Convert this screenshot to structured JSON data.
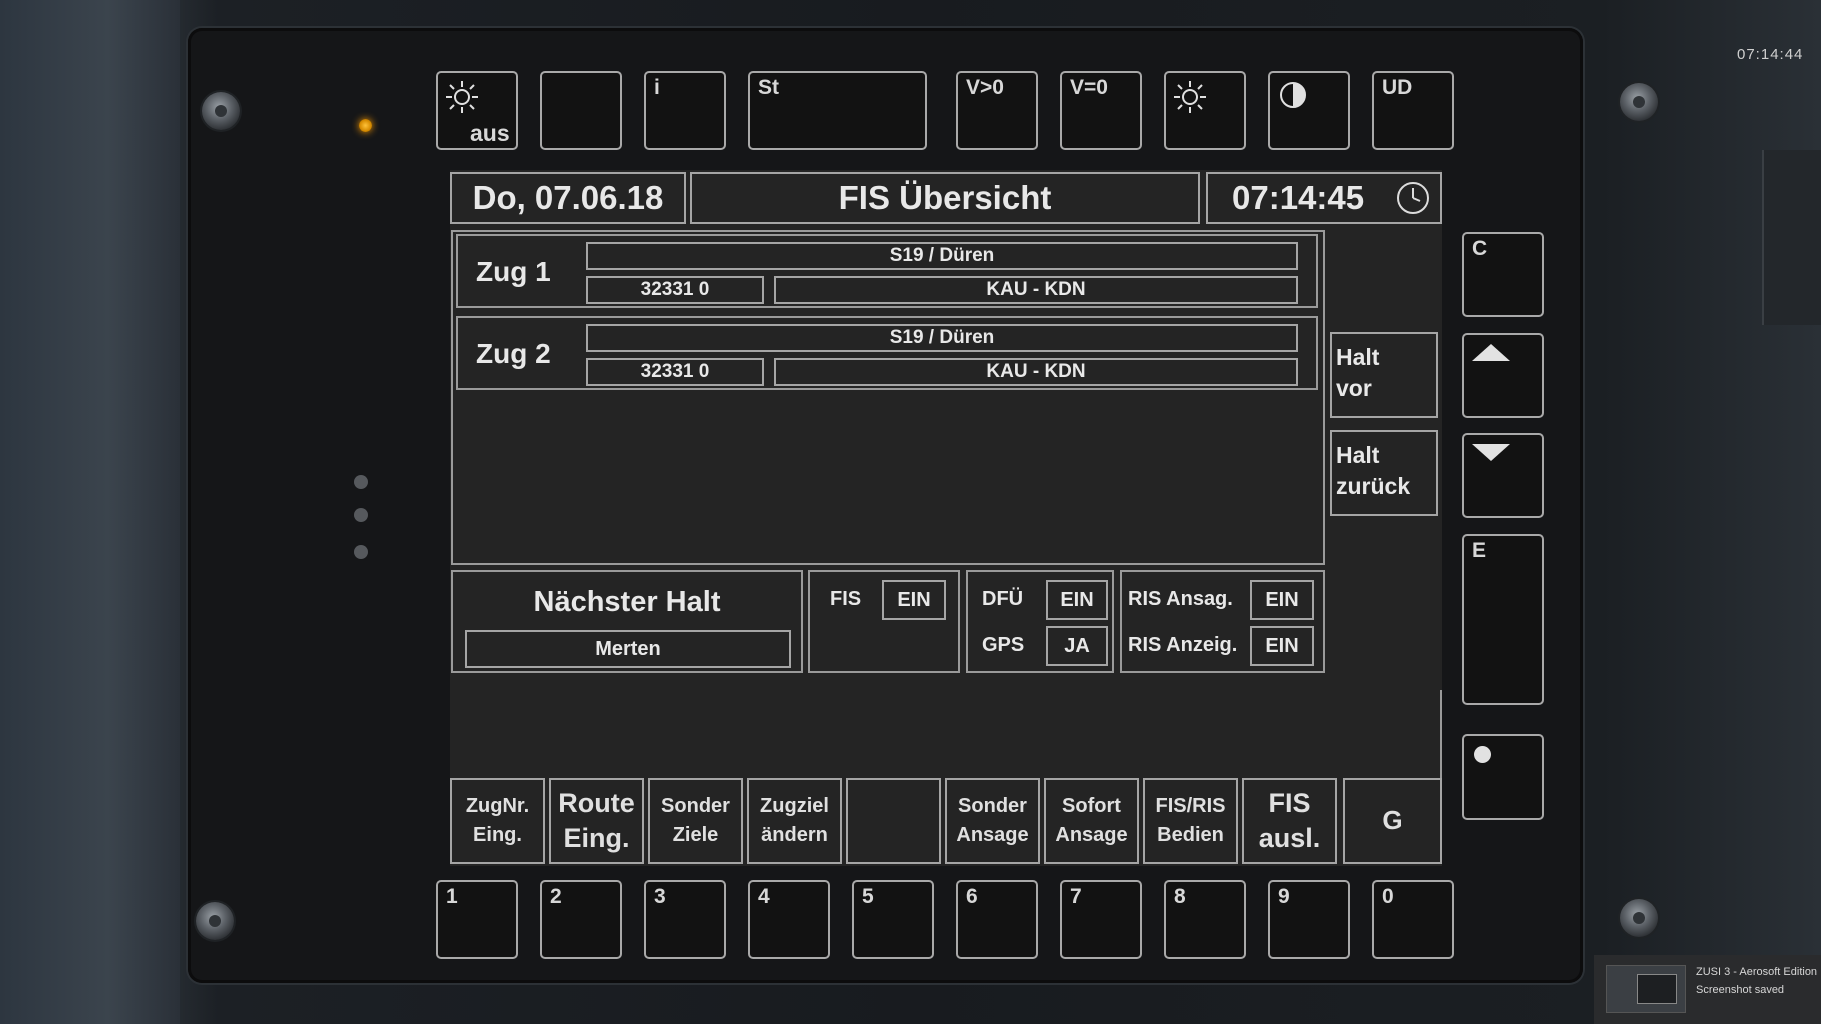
{
  "corner_clock": "07:14:44",
  "top_keys": [
    {
      "id": "brightness-off",
      "label": "aus",
      "icon": "sun-icon"
    },
    {
      "id": "blank",
      "label": ""
    },
    {
      "id": "info",
      "label": "i"
    },
    {
      "id": "st",
      "label": "St"
    },
    {
      "id": "v-gt-0",
      "label": "V>0"
    },
    {
      "id": "v-eq-0",
      "label": "V=0"
    },
    {
      "id": "brightness",
      "label": "",
      "icon": "sun-icon"
    },
    {
      "id": "contrast",
      "label": "",
      "icon": "contrast-icon"
    },
    {
      "id": "ud",
      "label": "UD"
    }
  ],
  "header": {
    "date": "Do, 07.06.18",
    "title": "FIS Übersicht",
    "time": "07:14:45",
    "clock_icon": "clock-icon"
  },
  "trains": [
    {
      "label": "Zug 1",
      "line": "S19 / Düren",
      "number": "32331 0",
      "route": "KAU - KDN"
    },
    {
      "label": "Zug 2",
      "line": "S19 / Düren",
      "number": "32331 0",
      "route": "KAU - KDN"
    }
  ],
  "side_buttons": {
    "halt_vor": [
      "Halt",
      "vor"
    ],
    "halt_zurueck": [
      "Halt",
      "zurück"
    ]
  },
  "next_stop": {
    "title": "Nächster Halt",
    "value": "Merten"
  },
  "status": {
    "fis_label": "FIS",
    "fis_value": "EIN",
    "dfu_label": "DFÜ",
    "dfu_value": "EIN",
    "gps_label": "GPS",
    "gps_value": "JA",
    "ris_ansag_label": "RIS Ansag.",
    "ris_ansag_value": "EIN",
    "ris_anzeig_label": "RIS Anzeig.",
    "ris_anzeig_value": "EIN"
  },
  "function_keys": [
    {
      "line1": "ZugNr.",
      "line2": "Eing."
    },
    {
      "line1": "Route",
      "line2": "Eing."
    },
    {
      "line1": "Sonder",
      "line2": "Ziele"
    },
    {
      "line1": "Zugziel",
      "line2": "ändern"
    },
    {
      "line1": "",
      "line2": ""
    },
    {
      "line1": "Sonder",
      "line2": "Ansage"
    },
    {
      "line1": "Sofort",
      "line2": "Ansage"
    },
    {
      "line1": "FIS/RIS",
      "line2": "Bedien"
    },
    {
      "line1": "FIS",
      "line2": "ausl."
    },
    {
      "line1": "G",
      "line2": ""
    }
  ],
  "right_keys": {
    "c": "C",
    "up_icon": "arrow-up-icon",
    "down_icon": "arrow-down-icon",
    "e": "E",
    "dot_icon": "dot-icon"
  },
  "digit_keys": [
    "1",
    "2",
    "3",
    "4",
    "5",
    "6",
    "7",
    "8",
    "9",
    "0"
  ],
  "notification": {
    "app": "ZUSI 3 - Aerosoft Edition",
    "message": "Screenshot saved"
  }
}
